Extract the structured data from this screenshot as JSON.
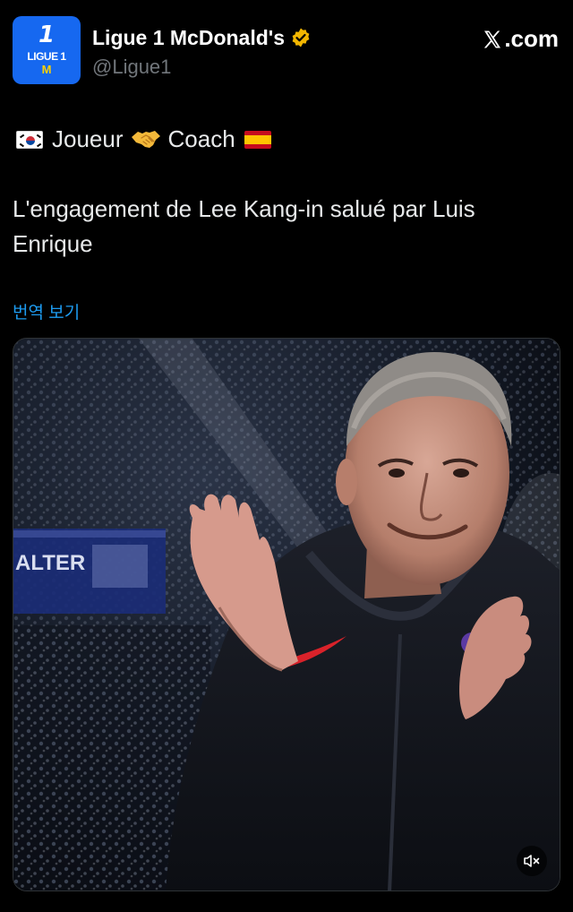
{
  "header": {
    "avatar": {
      "line1": "1",
      "line2": "LIGUE 1",
      "line3": "M"
    },
    "display_name": "Ligue 1 McDonald's",
    "verified_icon": "verified-badge-icon",
    "handle": "@Ligue1",
    "brand": ".com"
  },
  "tweet": {
    "line1": {
      "left_text": "Joueur",
      "right_text": "Coach",
      "left_flag": "south-korea-flag-icon",
      "middle_icon": "handshake-icon",
      "right_flag": "spain-flag-icon"
    },
    "text": "L'engagement de Lee Kang-in salué par Luis Enrique",
    "translate_label": "번역 보기"
  },
  "media": {
    "type": "video",
    "mute_icon": "speaker-muted-icon",
    "banner_text": "ALTER"
  },
  "colors": {
    "background": "#000000",
    "text": "#e7e9ea",
    "muted": "#71767b",
    "link": "#1d9bf0",
    "badge": "#f2b600",
    "avatar_bg": "#1668f0"
  }
}
